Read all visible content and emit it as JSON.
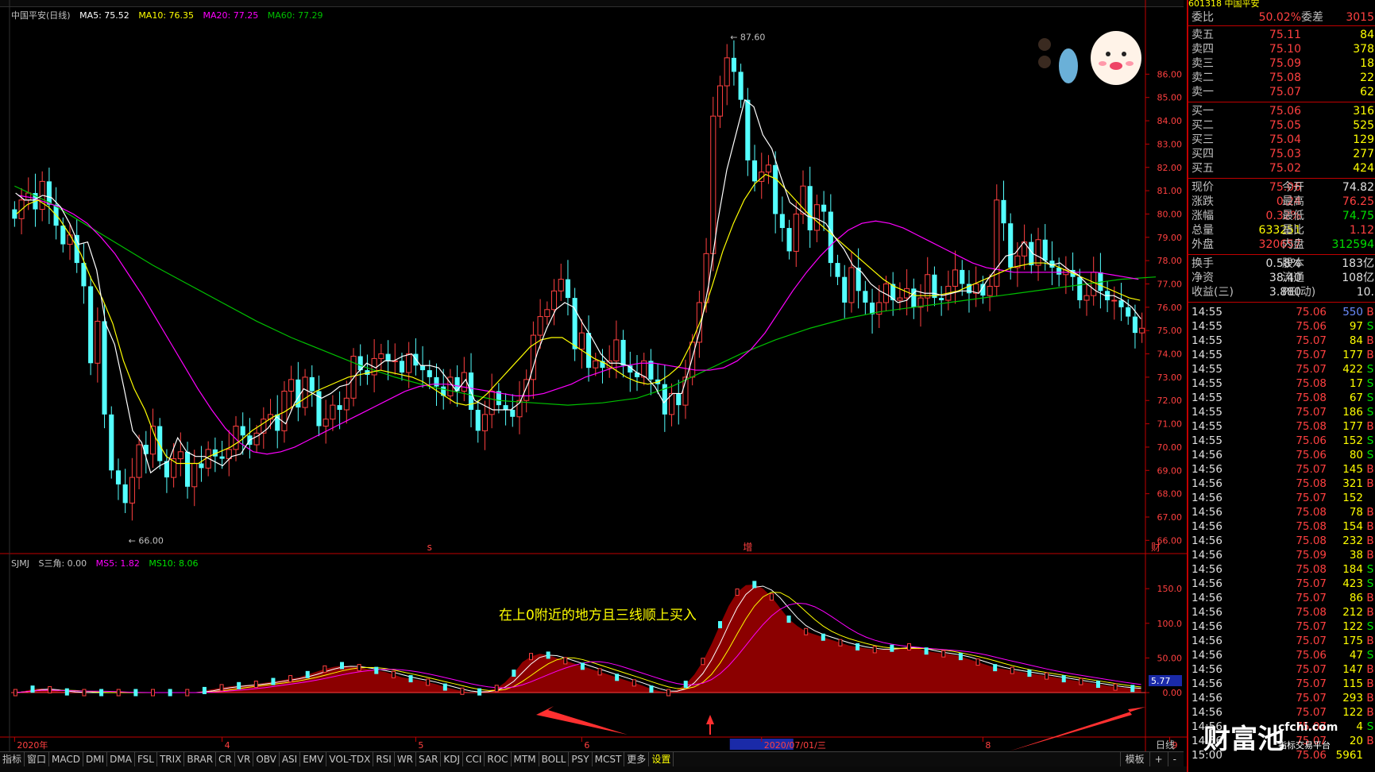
{
  "stock": {
    "code": "601318",
    "name": "中国平安",
    "title": "中国平安(日线)"
  },
  "colors": {
    "up": "#ff4040",
    "down": "#54ffff",
    "ma5": "#ffffff",
    "ma10": "#ffff00",
    "ma20": "#ff00ff",
    "ma60": "#00c000",
    "area": "#8b0000",
    "axis": "#c00000"
  },
  "main_legend": [
    {
      "label": "MA5: 75.52",
      "color": "#ffffff"
    },
    {
      "label": "MA10: 76.35",
      "color": "#ffff00"
    },
    {
      "label": "MA20: 77.25",
      "color": "#ff00ff"
    },
    {
      "label": "MA60: 77.29",
      "color": "#00c000"
    }
  ],
  "ind_legend": [
    {
      "label": "SJMJ",
      "color": "#c0c0c0"
    },
    {
      "label": "S三角: 0.00",
      "color": "#c0c0c0"
    },
    {
      "label": "MS5: 1.82",
      "color": "#ff00ff"
    },
    {
      "label": "MS10: 8.06",
      "color": "#00e000"
    }
  ],
  "annotation": "在上0附近的地方且三线顺上买入",
  "markers": [
    {
      "label": "s",
      "index": 60
    },
    {
      "label": "增",
      "index": 106
    },
    {
      "label": "财",
      "index": 165
    }
  ],
  "chart_data": [
    {
      "type": "candlestick",
      "title": "中国平安(日线)",
      "ylim": [
        65.5,
        88.5
      ],
      "y_ticks": [
        66.0,
        67.0,
        68.0,
        69.0,
        70.0,
        71.0,
        72.0,
        73.0,
        74.0,
        75.0,
        76.0,
        77.0,
        78.0,
        79.0,
        80.0,
        81.0,
        82.0,
        83.0,
        84.0,
        85.0,
        86.0
      ],
      "peak_label": "87.60",
      "trough_label": "66.00",
      "x_labels": [
        {
          "label": "2020年",
          "index": 0
        },
        {
          "label": "4",
          "index": 30
        },
        {
          "label": "5",
          "index": 58
        },
        {
          "label": "6",
          "index": 82
        },
        {
          "label": "2020/07/01/三",
          "index": 108
        },
        {
          "label": "8",
          "index": 140
        },
        {
          "label": "9",
          "index": 167
        }
      ],
      "close": [
        79.8,
        80.6,
        80.9,
        80.2,
        81.4,
        80.4,
        79.5,
        78.7,
        79.1,
        77.9,
        76.9,
        73.6,
        75.4,
        71.4,
        69.0,
        68.4,
        67.6,
        68.7,
        70.1,
        69.7,
        70.9,
        69.4,
        68.7,
        69.5,
        69.8,
        68.3,
        69.3,
        69.1,
        69.9,
        69.6,
        69.5,
        69.9,
        70.9,
        70.5,
        70.1,
        70.6,
        71.2,
        71.4,
        70.7,
        72.4,
        72.9,
        71.7,
        73.0,
        72.4,
        70.9,
        71.2,
        71.8,
        71.6,
        72.1,
        73.9,
        73.3,
        73.1,
        73.8,
        74.0,
        73.7,
        73.7,
        73.2,
        74.0,
        73.5,
        73.3,
        73.0,
        72.6,
        72.2,
        73.0,
        72.4,
        73.2,
        71.6,
        70.7,
        71.4,
        72.4,
        71.8,
        71.6,
        71.3,
        72.0,
        72.9,
        74.8,
        75.6,
        75.9,
        76.7,
        77.2,
        76.4,
        74.2,
        74.9,
        73.4,
        73.7,
        73.4,
        73.7,
        74.6,
        73.5,
        73.2,
        73.0,
        73.7,
        72.9,
        72.7,
        71.4,
        72.3,
        71.8,
        73.0,
        74.5,
        76.2,
        78.3,
        84.2,
        85.5,
        86.7,
        86.1,
        84.9,
        82.3,
        81.4,
        81.8,
        82.1,
        80.0,
        79.4,
        78.4,
        80.0,
        81.2,
        79.3,
        80.4,
        80.1,
        77.9,
        77.3,
        76.2,
        77.7,
        76.7,
        76.2,
        75.7,
        76.2,
        77.0,
        76.3,
        76.4,
        76.8,
        76.0,
        76.4,
        77.4,
        76.4,
        76.3,
        76.9,
        77.6,
        77.0,
        76.6,
        77.0,
        76.5,
        76.9,
        80.6,
        79.6,
        77.7,
        78.2,
        78.8,
        77.8,
        78.9,
        78.0,
        77.7,
        77.4,
        77.6,
        77.3,
        76.3,
        76.5,
        77.5,
        76.7,
        76.3,
        76.3,
        76.0,
        75.6,
        74.9,
        75.1
      ],
      "ma5": [
        80.9,
        80.6,
        80.6,
        80.8,
        80.7,
        80.3,
        79.6,
        78.7,
        78.8,
        77.6,
        75.3,
        74.4,
        72.6,
        70.7,
        70.2,
        68.9,
        69.2,
        69.4,
        70.4,
        69.8,
        69.6,
        69.6,
        69.4,
        69.2,
        69.6,
        69.7,
        70.3,
        70.5,
        70.8,
        71.3,
        71.0,
        71.9,
        72.5,
        72.3,
        72.1,
        72.3,
        72.6,
        72.7,
        73.2,
        73.6,
        73.4,
        73.7,
        73.7,
        73.9,
        74.0,
        73.5,
        73.5,
        73.4,
        72.9,
        72.4,
        72.9,
        72.0,
        71.8,
        71.6,
        71.6,
        71.6,
        71.9,
        72.8,
        74.1,
        75.1,
        75.9,
        76.2,
        76.0,
        75.3,
        74.7,
        74.0,
        73.6,
        73.6,
        73.5,
        73.2,
        73.0,
        72.6,
        71.9,
        72.3,
        72.3,
        73.6,
        75.0,
        77.0,
        79.7,
        81.9,
        83.4,
        84.9,
        84.6,
        83.4,
        82.8,
        81.6,
        80.5,
        80.2,
        79.9,
        79.8,
        79.6,
        79.0,
        78.5,
        77.8,
        77.5,
        77.0,
        76.7,
        76.5,
        76.2,
        76.3,
        76.7,
        76.6,
        76.6,
        76.5,
        76.6,
        76.7,
        76.7,
        76.6,
        77.2,
        77.7,
        78.2,
        78.3,
        78.8,
        78.3,
        78.1,
        77.8,
        77.9,
        77.6,
        77.4,
        77.0,
        76.7,
        76.5,
        76.5,
        76.3,
        76.0,
        75.5
      ],
      "ma10": [
        80.0,
        80.4,
        80.6,
        80.3,
        79.8,
        79.1,
        78.3,
        77.2,
        76.4,
        75.3,
        73.7,
        72.5,
        71.6,
        70.4,
        69.6,
        69.3,
        69.3,
        69.3,
        69.6,
        69.8,
        70.0,
        70.3,
        70.7,
        71.0,
        71.3,
        71.5,
        71.8,
        72.1,
        72.4,
        72.6,
        72.8,
        73.0,
        73.1,
        73.2,
        73.3,
        73.2,
        73.1,
        73.0,
        72.8,
        72.5,
        72.2,
        71.9,
        71.8,
        71.9,
        72.3,
        72.8,
        73.3,
        73.8,
        74.3,
        74.6,
        74.7,
        74.7,
        74.4,
        74.1,
        73.8,
        73.6,
        73.3,
        73.0,
        72.8,
        72.7,
        72.8,
        73.1,
        73.5,
        74.4,
        75.5,
        76.9,
        78.4,
        79.6,
        80.6,
        81.3,
        81.7,
        81.5,
        81.0,
        80.5,
        80.0,
        79.6,
        79.2,
        78.8,
        78.4,
        78.0,
        77.6,
        77.2,
        76.9,
        76.7,
        76.5,
        76.5,
        76.5,
        76.6,
        76.7,
        76.9,
        77.1,
        77.3,
        77.5,
        77.7,
        77.8,
        77.9,
        77.9,
        77.8,
        77.6,
        77.4,
        77.2,
        77.0,
        76.8,
        76.6,
        76.4,
        76.3
      ],
      "ma20": [
        80.8,
        80.7,
        80.5,
        80.3,
        80.0,
        79.6,
        79.0,
        78.3,
        77.4,
        76.5,
        75.5,
        74.5,
        73.5,
        72.5,
        71.6,
        70.8,
        70.2,
        69.8,
        69.7,
        69.8,
        70.0,
        70.3,
        70.6,
        70.9,
        71.2,
        71.5,
        71.8,
        72.1,
        72.4,
        72.6,
        72.7,
        72.7,
        72.6,
        72.5,
        72.4,
        72.3,
        72.2,
        72.2,
        72.3,
        72.5,
        72.7,
        73.0,
        73.2,
        73.4,
        73.5,
        73.6,
        73.6,
        73.5,
        73.4,
        73.3,
        73.3,
        73.4,
        73.7,
        74.2,
        74.9,
        75.8,
        76.7,
        77.5,
        78.2,
        78.8,
        79.3,
        79.6,
        79.7,
        79.6,
        79.4,
        79.1,
        78.8,
        78.5,
        78.2,
        77.9,
        77.7,
        77.6,
        77.5,
        77.5,
        77.5,
        77.5,
        77.5,
        77.5,
        77.5,
        77.4,
        77.3,
        77.2
      ],
      "ma60": [
        81.2,
        80.5,
        79.6,
        78.7,
        77.8,
        77.0,
        76.2,
        75.4,
        74.7,
        74.1,
        73.5,
        73.0,
        72.6,
        72.3,
        72.0,
        71.9,
        71.8,
        71.9,
        72.1,
        72.6,
        73.3,
        74.0,
        74.6,
        75.1,
        75.5,
        75.8,
        76.0,
        76.2,
        76.4,
        76.6,
        76.8,
        77.0,
        77.2,
        77.3
      ],
      "ma60_x": [
        0,
        5,
        10,
        15,
        20,
        25,
        30,
        35,
        40,
        45,
        50,
        55,
        60,
        65,
        70,
        75,
        80,
        85,
        90,
        95,
        100,
        105,
        110,
        115,
        120,
        125,
        130,
        135,
        140,
        145,
        150,
        155,
        160,
        165
      ],
      "ma20_x_step": 2,
      "ma10_x_step": 1.64,
      "ma5_x_step": 1.35
    },
    {
      "type": "area",
      "title": "SJMJ",
      "ylim": [
        -55,
        180
      ],
      "y_ticks": [
        0.0,
        50.0,
        100.0,
        150.0
      ],
      "current_label": "5.77",
      "x_labels": [
        {
          "label": "2020年",
          "index": 0
        },
        {
          "label": "4",
          "index": 30
        },
        {
          "label": "5",
          "index": 58
        },
        {
          "label": "6",
          "index": 82
        },
        {
          "label": "2020/07/01/三",
          "index": 108
        },
        {
          "label": "8",
          "index": 140
        },
        {
          "label": "9",
          "index": 167
        }
      ],
      "values": [
        0,
        2,
        5,
        6,
        4,
        2,
        1,
        0,
        0,
        0,
        0,
        0,
        0,
        0,
        0,
        0,
        0,
        0,
        0,
        0,
        0,
        0,
        3,
        5,
        7,
        9,
        10,
        11,
        12,
        14,
        16,
        18,
        20,
        22,
        26,
        30,
        34,
        37,
        39,
        38,
        36,
        34,
        32,
        30,
        26,
        22,
        20,
        18,
        15,
        12,
        8,
        5,
        2,
        0,
        1,
        3,
        6,
        15,
        28,
        44,
        52,
        56,
        54,
        50,
        46,
        42,
        38,
        34,
        30,
        26,
        22,
        18,
        14,
        10,
        5,
        2,
        0,
        4,
        12,
        26,
        45,
        70,
        98,
        125,
        145,
        155,
        156,
        150,
        138,
        122,
        106,
        96,
        88,
        84,
        80,
        76,
        72,
        68,
        66,
        64,
        62,
        62,
        64,
        65,
        66,
        64,
        60,
        58,
        56,
        55,
        52,
        48,
        44,
        40,
        36,
        34,
        32,
        30,
        28,
        26,
        24,
        22,
        20,
        18,
        16,
        14,
        12,
        10,
        8,
        7,
        6,
        5
      ]
    }
  ],
  "tabs": [
    "指标",
    "窗口",
    "MACD",
    "DMI",
    "DMA",
    "FSL",
    "TRIX",
    "BRAR",
    "CR",
    "VR",
    "OBV",
    "ASI",
    "EMV",
    "VOL-TDX",
    "RSI",
    "WR",
    "SAR",
    "KDJ",
    "CCI",
    "ROC",
    "MTM",
    "BOLL",
    "PSY",
    "MCST",
    "更多",
    "设置"
  ],
  "tabs_right": [
    "模板",
    "+",
    "-"
  ],
  "period_label": "日线",
  "panel": {
    "header": "601318 中国平安",
    "weibi": {
      "label": "委比",
      "value": "50.02%",
      "label2": "委差",
      "value2": "3015"
    },
    "sells": [
      {
        "label": "卖五",
        "price": "75.11",
        "vol": "84"
      },
      {
        "label": "卖四",
        "price": "75.10",
        "vol": "378"
      },
      {
        "label": "卖三",
        "price": "75.09",
        "vol": "18"
      },
      {
        "label": "卖二",
        "price": "75.08",
        "vol": "22"
      },
      {
        "label": "卖一",
        "price": "75.07",
        "vol": "62"
      }
    ],
    "buys": [
      {
        "label": "买一",
        "price": "75.06",
        "vol": "316"
      },
      {
        "label": "买二",
        "price": "75.05",
        "vol": "525"
      },
      {
        "label": "买三",
        "price": "75.04",
        "vol": "129"
      },
      {
        "label": "买四",
        "price": "75.03",
        "vol": "277"
      },
      {
        "label": "买五",
        "price": "75.02",
        "vol": "424"
      }
    ],
    "stats": [
      {
        "l1": "现价",
        "v1": "75.06",
        "c1": "red",
        "l2": "今开",
        "v2": "74.82",
        "c2": "white"
      },
      {
        "l1": "涨跌",
        "v1": "0.24",
        "c1": "red",
        "l2": "最高",
        "v2": "76.25",
        "c2": "red"
      },
      {
        "l1": "涨幅",
        "v1": "0.32%",
        "c1": "red",
        "l2": "最低",
        "v2": "74.75",
        "c2": "green"
      },
      {
        "l1": "总量",
        "v1": "633251",
        "c1": "yellow",
        "l2": "量比",
        "v2": "1.12",
        "c2": "red"
      },
      {
        "l1": "外盘",
        "v1": "320657",
        "c1": "red",
        "l2": "内盘",
        "v2": "312594",
        "c2": "green"
      }
    ],
    "stats2": [
      {
        "l1": "换手",
        "v1": "0.58%",
        "c1": "white",
        "l2": "股本",
        "v2": "183亿",
        "c2": "white"
      },
      {
        "l1": "净资",
        "v1": "38.40",
        "c1": "white",
        "l2": "流通",
        "v2": "108亿",
        "c2": "white"
      },
      {
        "l1": "收益(三)",
        "v1": "3.880",
        "c1": "white",
        "l2": "PE(动)",
        "v2": "10.",
        "c2": "white"
      }
    ],
    "ticks": [
      {
        "t": "14:55",
        "p": "75.06",
        "q": "550",
        "s": "B",
        "qc": "blue"
      },
      {
        "t": "14:55",
        "p": "75.06",
        "q": "97",
        "s": "S"
      },
      {
        "t": "14:55",
        "p": "75.07",
        "q": "84",
        "s": "B"
      },
      {
        "t": "14:55",
        "p": "75.07",
        "q": "177",
        "s": "B"
      },
      {
        "t": "14:55",
        "p": "75.07",
        "q": "422",
        "s": "S"
      },
      {
        "t": "14:55",
        "p": "75.08",
        "q": "17",
        "s": "S"
      },
      {
        "t": "14:55",
        "p": "75.08",
        "q": "67",
        "s": "S"
      },
      {
        "t": "14:55",
        "p": "75.07",
        "q": "186",
        "s": "S"
      },
      {
        "t": "14:55",
        "p": "75.08",
        "q": "177",
        "s": "B"
      },
      {
        "t": "14:55",
        "p": "75.06",
        "q": "152",
        "s": "S"
      },
      {
        "t": "14:56",
        "p": "75.06",
        "q": "80",
        "s": "S"
      },
      {
        "t": "14:56",
        "p": "75.07",
        "q": "145",
        "s": "B"
      },
      {
        "t": "14:56",
        "p": "75.08",
        "q": "321",
        "s": "B"
      },
      {
        "t": "14:56",
        "p": "75.07",
        "q": "152",
        "s": ""
      },
      {
        "t": "14:56",
        "p": "75.08",
        "q": "78",
        "s": "B"
      },
      {
        "t": "14:56",
        "p": "75.08",
        "q": "154",
        "s": "B"
      },
      {
        "t": "14:56",
        "p": "75.08",
        "q": "232",
        "s": "B"
      },
      {
        "t": "14:56",
        "p": "75.09",
        "q": "38",
        "s": "B"
      },
      {
        "t": "14:56",
        "p": "75.08",
        "q": "184",
        "s": "S"
      },
      {
        "t": "14:56",
        "p": "75.07",
        "q": "423",
        "s": "S"
      },
      {
        "t": "14:56",
        "p": "75.07",
        "q": "86",
        "s": "B"
      },
      {
        "t": "14:56",
        "p": "75.08",
        "q": "212",
        "s": "B"
      },
      {
        "t": "14:56",
        "p": "75.07",
        "q": "122",
        "s": "S"
      },
      {
        "t": "14:56",
        "p": "75.07",
        "q": "175",
        "s": "B"
      },
      {
        "t": "14:56",
        "p": "75.06",
        "q": "47",
        "s": "S"
      },
      {
        "t": "14:56",
        "p": "75.07",
        "q": "147",
        "s": "B"
      },
      {
        "t": "14:56",
        "p": "75.07",
        "q": "115",
        "s": "B"
      },
      {
        "t": "14:56",
        "p": "75.07",
        "q": "293",
        "s": "B"
      },
      {
        "t": "14:56",
        "p": "75.07",
        "q": "122",
        "s": "B"
      },
      {
        "t": "14:56",
        "p": "75.07",
        "q": "4",
        "s": "S"
      },
      {
        "t": "14:56",
        "p": "75.07",
        "q": "20",
        "s": "B"
      },
      {
        "t": "15:00",
        "p": "75.06",
        "q": "5961",
        "s": "",
        "qc": "yellow"
      }
    ]
  },
  "watermark": {
    "text": "财富池",
    "site": "cfchi.com",
    "sub": "指标交易平台"
  }
}
